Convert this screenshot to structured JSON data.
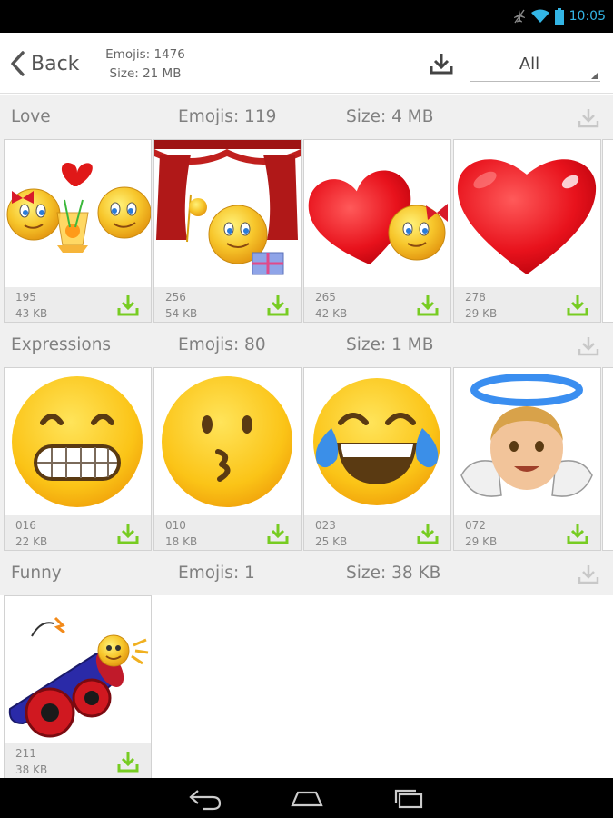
{
  "status_bar": {
    "time": "10:05"
  },
  "toolbar": {
    "back_label": "Back",
    "emoji_total": "Emojis: 1476",
    "total_size": "Size: 21 MB",
    "filter_value": "All"
  },
  "sections": [
    {
      "name": "Love",
      "count": "Emojis: 119",
      "size": "Size: 4 MB",
      "cards": [
        {
          "number": "195",
          "size": "43 KB",
          "image": "two-smileys-sharing-drink-with-heart"
        },
        {
          "number": "256",
          "size": "54 KB",
          "image": "smiley-with-gift-curtains"
        },
        {
          "number": "265",
          "size": "42 KB",
          "image": "happy-valentine-heart"
        },
        {
          "number": "278",
          "size": "29 KB",
          "image": "red-heart"
        }
      ]
    },
    {
      "name": "Expressions",
      "count": "Emojis: 80",
      "size": "Size: 1 MB",
      "cards": [
        {
          "number": "016",
          "size": "22 KB",
          "image": "grimacing-face"
        },
        {
          "number": "010",
          "size": "18 KB",
          "image": "kissing-face"
        },
        {
          "number": "023",
          "size": "25 KB",
          "image": "tears-of-joy-face"
        },
        {
          "number": "072",
          "size": "29 KB",
          "image": "baby-angel"
        }
      ]
    },
    {
      "name": "Funny",
      "count": "Emojis: 1",
      "size": "Size: 38 KB",
      "cards": [
        {
          "number": "211",
          "size": "38 KB",
          "image": "smiley-on-cannon"
        }
      ]
    }
  ],
  "colors": {
    "accent_green": "#77cc22",
    "status_blue": "#33b5e5",
    "section_bg": "#f0f0f0"
  }
}
